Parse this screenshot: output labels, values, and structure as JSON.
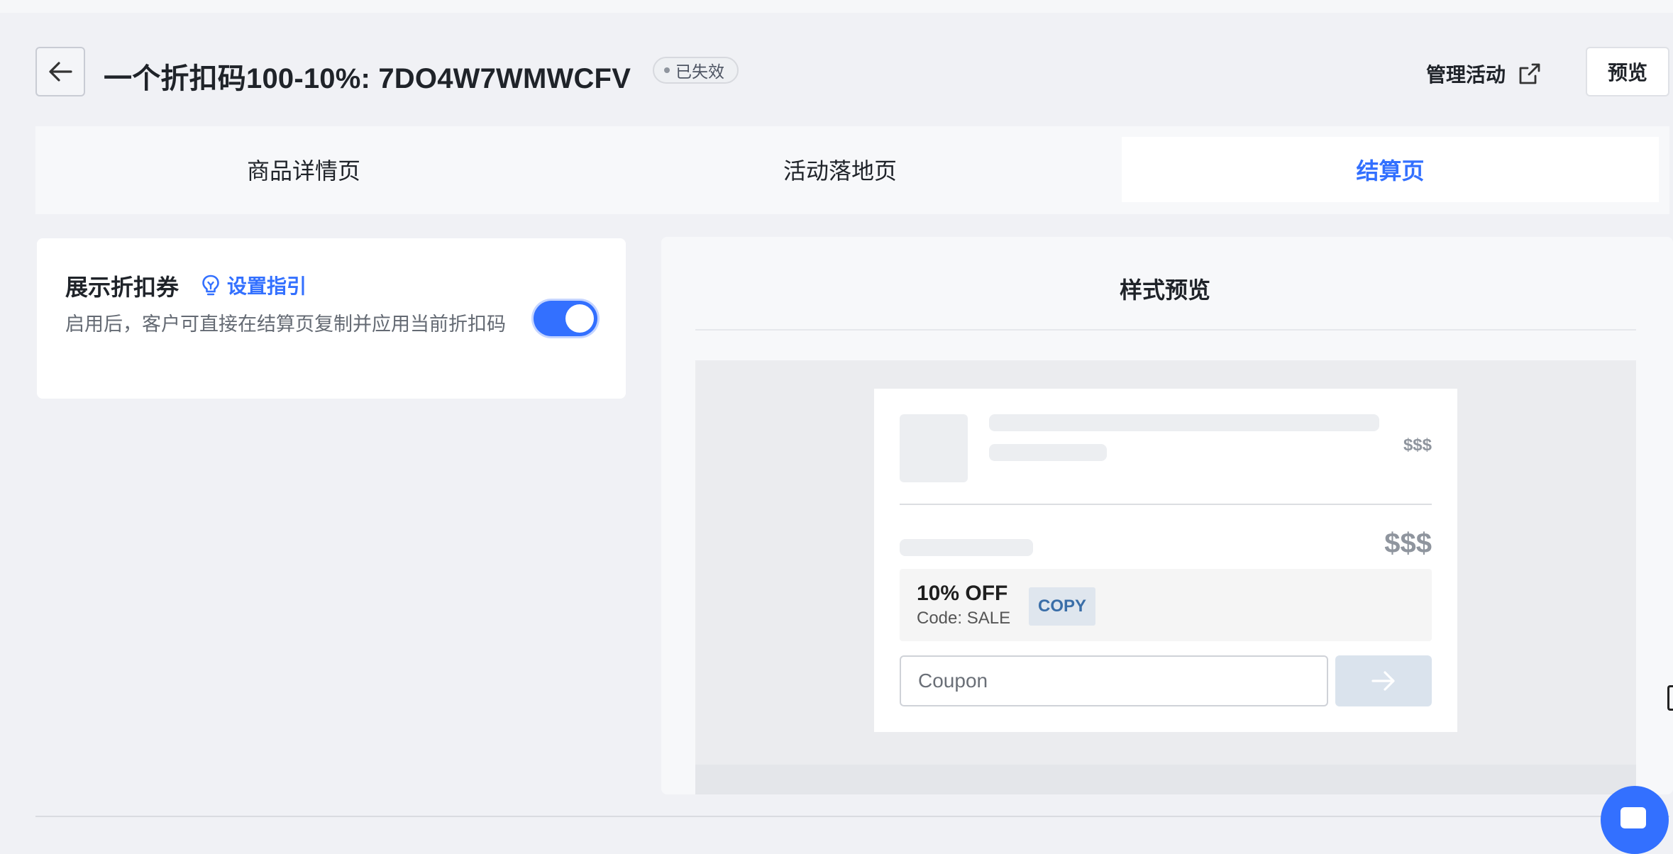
{
  "header": {
    "title": "一个折扣码100-10%: 7DO4W7WMWCFV",
    "status": "已失效",
    "manage_label": "管理活动",
    "preview_label": "预览"
  },
  "tabs": [
    {
      "label": "商品详情页",
      "active": false
    },
    {
      "label": "活动落地页",
      "active": false
    },
    {
      "label": "结算页",
      "active": true
    }
  ],
  "setting": {
    "title": "展示折扣券",
    "guide_label": "设置指引",
    "description": "启用后，客户可直接在结算页复制并应用当前折扣码",
    "enabled": true
  },
  "preview": {
    "title": "样式预览",
    "line_price": "$$$",
    "subtotal_price": "$$$",
    "coupon_off": "10% OFF",
    "coupon_code": "Code: SALE",
    "copy_label": "COPY",
    "coupon_placeholder": "Coupon"
  },
  "colors": {
    "accent": "#3370ff",
    "background": "#f0f1f5",
    "copy_text": "#3a6ea8"
  },
  "icons": {
    "back": "arrow-left-icon",
    "external": "external-link-icon",
    "guide": "lightbulb-icon",
    "apply": "arrow-right-icon",
    "chat": "chat-icon"
  }
}
